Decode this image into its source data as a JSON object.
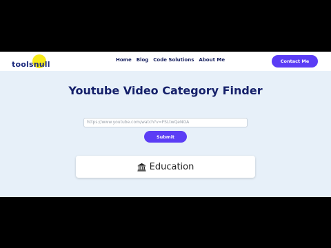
{
  "navbar": {
    "logo_text": "toolsnull",
    "links": [
      "Home",
      "Blog",
      "Code Solutions",
      "About Me"
    ],
    "contact_label": "Contact Me"
  },
  "main": {
    "title": "Youtube Video Category Finder",
    "url_value": "https://www.youtube.com/watch?v=FSLtwQeNGA",
    "submit_label": "Submit",
    "result": {
      "icon": "bank-icon",
      "category": "Education"
    }
  },
  "colors": {
    "accent": "#5b3df5",
    "heading": "#15206a",
    "background": "#e7f0f9",
    "logo_dot": "#f7ea1a"
  }
}
